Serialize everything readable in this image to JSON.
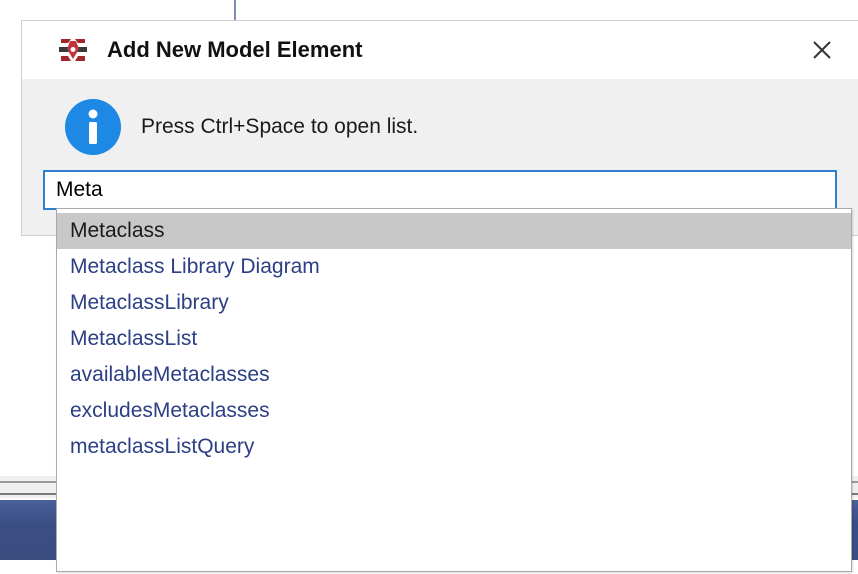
{
  "dialog": {
    "title": "Add New Model Element",
    "close_label": "×",
    "info_text": "Press Ctrl+Space to open list.",
    "search_value": "Meta"
  },
  "autocomplete": {
    "selected_index": 0,
    "items": [
      {
        "label": "Metaclass"
      },
      {
        "label": "Metaclass Library Diagram"
      },
      {
        "label": "MetaclassLibrary"
      },
      {
        "label": "MetaclassList"
      },
      {
        "label": "availableMetaclasses"
      },
      {
        "label": "excludesMetaclasses"
      },
      {
        "label": "metaclassListQuery"
      }
    ]
  },
  "icons": {
    "app": "app-logo-icon",
    "close": "close-icon",
    "info": "info-icon"
  },
  "colors": {
    "accent": "#2f7fd0",
    "info_blue": "#1e88e5",
    "item_text": "#2c3e84",
    "selected_bg": "#c8c8c8",
    "logo_red": "#a0282c"
  }
}
